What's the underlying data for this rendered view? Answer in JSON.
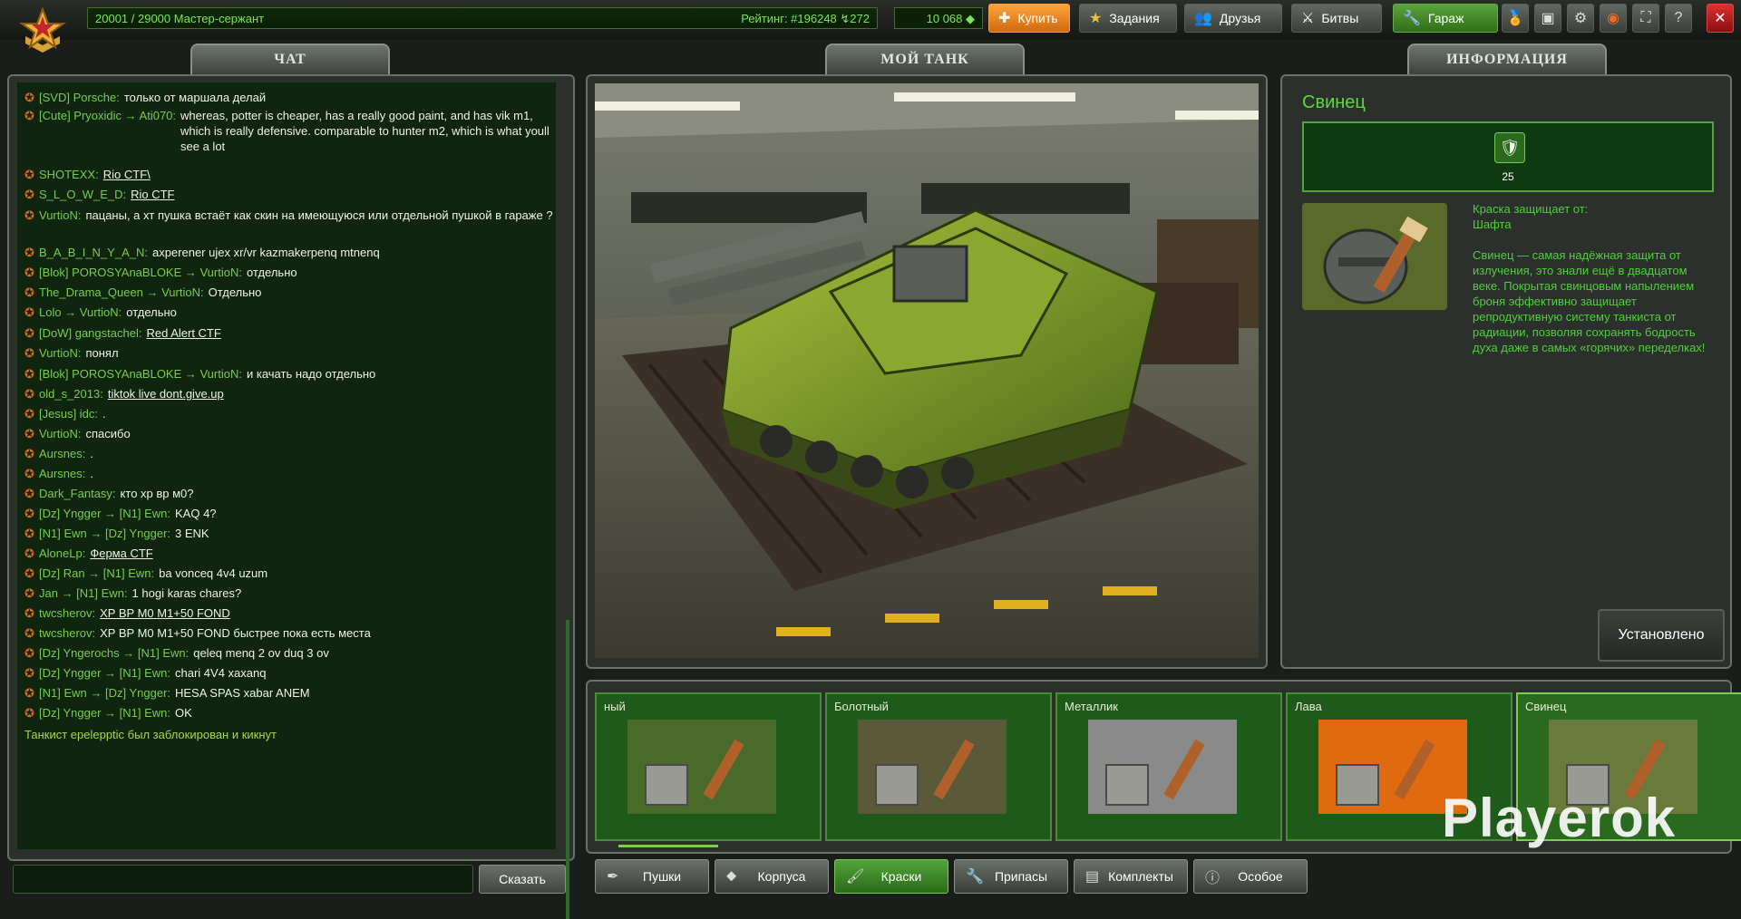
{
  "topbar": {
    "xp": "20001 / 29000",
    "rank_title": "Мастер-сержант",
    "xp_progress": 0.0,
    "rating": "Рейтинг: #196248",
    "rating_delta": "↯272",
    "crystals": "10 068",
    "buy_label": "Купить",
    "missions_label": "Задания",
    "friends_label": "Друзья",
    "battles_label": "Битвы",
    "garage_label": "Гараж",
    "close_label": "✕",
    "help_label": "?"
  },
  "tabs": {
    "chat": "ЧАТ",
    "mytank": "МОЙ ТАНК",
    "info": "ИНФОРМАЦИЯ"
  },
  "chat": {
    "messages": [
      {
        "nick": "[SVD] Porsche:",
        "text": "только от маршала делай"
      },
      {
        "nick": "[Cute] Pryoxidic → Ati070:",
        "text": "whereas, potter is cheaper, has a really good paint, and has vik m1, which is really defensive. comparable to hunter m2, which is what youll see a lot"
      },
      {
        "nick": "SHOTEXX:",
        "text": "Rio CTF\\",
        "link": true
      },
      {
        "nick": "S_L_O_W_E_D:",
        "text": "Rio CTF",
        "link": true
      },
      {
        "nick": "VurtioN:",
        "text": "пацаны, а хт пушка встаёт как скин на имеющуюся или отдельной пушкой в гараже ?"
      },
      {
        "nick": "B_A_B_I_N_Y_A_N:",
        "text": "axperener ujex xr/vr kazmakerpenq mtnenq"
      },
      {
        "nick": "[Blok] POROSYAnaBLOKE → VurtioN:",
        "text": "отдельно"
      },
      {
        "nick": "The_Drama_Queen → VurtioN:",
        "text": "Отдельно"
      },
      {
        "nick": "Lolo → VurtioN:",
        "text": "отдельно"
      },
      {
        "nick": "[DoW] gangstachel:",
        "text": "Red Alert CTF",
        "link": true
      },
      {
        "nick": "VurtioN:",
        "text": "понял"
      },
      {
        "nick": "[Blok] POROSYAnaBLOKE → VurtioN:",
        "text": "и качать надо отдельно"
      },
      {
        "nick": "old_s_2013:",
        "text": "tiktok live dont.give.up",
        "link": true
      },
      {
        "nick": "[Jesus] idc:",
        "text": "."
      },
      {
        "nick": "VurtioN:",
        "text": "спасибо"
      },
      {
        "nick": "Aursnes:",
        "text": "."
      },
      {
        "nick": "Aursnes:",
        "text": "."
      },
      {
        "nick": "Dark_Fantasy:",
        "text": "кто хр вр м0?"
      },
      {
        "nick": "[Dz] Yngger → [N1] Ewn:",
        "text": "KAQ 4?"
      },
      {
        "nick": "[N1] Ewn → [Dz] Yngger:",
        "text": "3 ENK"
      },
      {
        "nick": "AloneLp:",
        "text": "Ферма CTF",
        "link": true
      },
      {
        "nick": "[Dz] Ran → [N1] Ewn:",
        "text": "ba vonceq 4v4 uzum"
      },
      {
        "nick": "Jan → [N1] Ewn:",
        "text": "1 hogi karas chares?"
      },
      {
        "nick": "twcsherov:",
        "text": "XP BP M0 M1+50 FOND",
        "link": true
      },
      {
        "nick": "twcsherov:",
        "text": "XP BP M0 M1+50 FOND быстрее пока есть места",
        "link_part": true
      },
      {
        "nick": "[Dz] Yngerochs → [N1] Ewn:",
        "text": "qeleq menq 2 ov duq 3 ov"
      },
      {
        "nick": "[Dz] Yngger → [N1] Ewn:",
        "text": "chari 4V4 xaxanq"
      },
      {
        "nick": "[N1] Ewn → [Dz] Yngger:",
        "text": "HESA SPAS xabar ANEM"
      },
      {
        "nick": "[Dz] Yngger → [N1] Ewn:",
        "text": "OK"
      }
    ],
    "system_message": "Танкист epelepptic был заблокирован и кикнут",
    "say_label": "Сказать",
    "input_value": ""
  },
  "info": {
    "title": "Свинец",
    "protection_value": "25",
    "protects_label": "Краска защищает от:",
    "protects_from": "Шафта",
    "description": "Свинец — самая надёжная защита от излучения, это знали ещё в двадцатом веке. Покрытая свинцовым напылением броня эффективно защищает репродуктивную систему танкиста от радиации, позволяя сохранять бодрость духа даже в самых «горячих» переделках!",
    "installed_label": "Установлено"
  },
  "items": [
    {
      "name": "ный",
      "color": "#4a6a2a"
    },
    {
      "name": "Болотный",
      "color": "#5a5a3a"
    },
    {
      "name": "Металлик",
      "color": "#8a8a8a"
    },
    {
      "name": "Лава",
      "color": "#e06a10"
    },
    {
      "name": "Свинец",
      "color": "#6a7a3a"
    }
  ],
  "categories": {
    "guns": "Пушки",
    "hulls": "Корпуса",
    "paints": "Краски",
    "supplies": "Припасы",
    "kits": "Комплекты",
    "special": "Особое"
  },
  "watermark": "Playerok"
}
